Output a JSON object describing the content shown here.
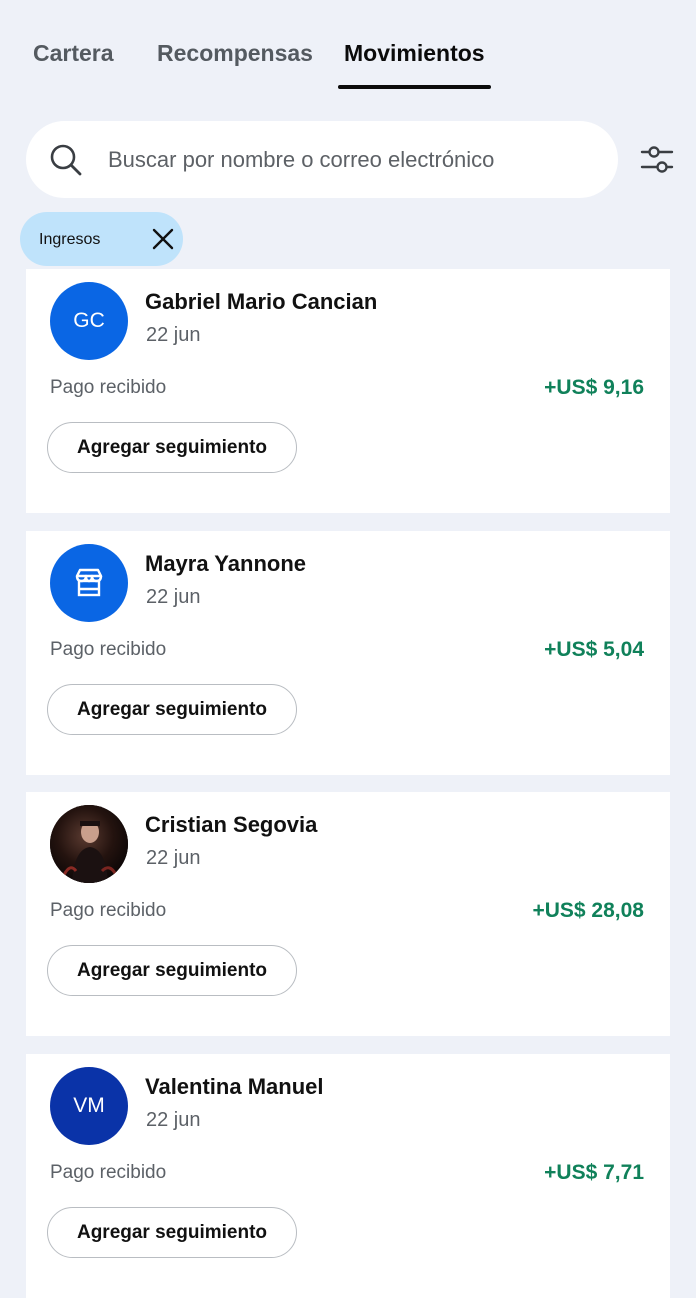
{
  "tabs": [
    {
      "label": "Cartera"
    },
    {
      "label": "Recompensas"
    },
    {
      "label": "Movimientos"
    }
  ],
  "search": {
    "placeholder": "Buscar por nombre o correo electrónico"
  },
  "filter_chip": {
    "label": "Ingresos"
  },
  "colors": {
    "accent_blue": "#0a66e4",
    "dark_blue": "#0a33a8",
    "positive_green": "#10815a",
    "chip_bg": "#bfe3fb"
  },
  "transactions": [
    {
      "initials": "GC",
      "avatar_type": "initials",
      "name": "Gabriel Mario Cancian",
      "date": "22 jun",
      "status": "Pago recibido",
      "amount": "+US$ 9,16",
      "action": "Agregar seguimiento"
    },
    {
      "initials": "",
      "avatar_type": "store-icon",
      "name": "Mayra Yannone",
      "date": "22 jun",
      "status": "Pago recibido",
      "amount": "+US$ 5,04",
      "action": "Agregar seguimiento"
    },
    {
      "initials": "",
      "avatar_type": "photo",
      "name": "Cristian Segovia",
      "date": "22 jun",
      "status": "Pago recibido",
      "amount": "+US$ 28,08",
      "action": "Agregar seguimiento"
    },
    {
      "initials": "VM",
      "avatar_type": "initials",
      "name": "Valentina Manuel",
      "date": "22 jun",
      "status": "Pago recibido",
      "amount": "+US$ 7,71",
      "action": "Agregar seguimiento"
    }
  ]
}
